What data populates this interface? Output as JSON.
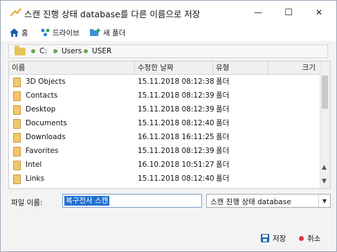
{
  "window": {
    "title": "스캔 진행 상태 database를 다른 이름으로 저장",
    "controls": {
      "minimize": "—",
      "maximize": "☐",
      "close": "✕"
    }
  },
  "toolbar": {
    "home": "홈",
    "drives": "드라이브",
    "new_folder": "새 폴더"
  },
  "path": {
    "segments": [
      "C:",
      "Users",
      "USER"
    ]
  },
  "table": {
    "columns": [
      "이름",
      "수정한 날짜",
      "유형",
      "크기"
    ],
    "rows": [
      {
        "name": "3D Objects",
        "date": "15.11.2018 08:12:38",
        "type": "폴더"
      },
      {
        "name": "Contacts",
        "date": "15.11.2018 08:12:39",
        "type": "폴더"
      },
      {
        "name": "Desktop",
        "date": "15.11.2018 08:12:39",
        "type": "폴더"
      },
      {
        "name": "Documents",
        "date": "15.11.2018 08:12:40",
        "type": "폴더"
      },
      {
        "name": "Downloads",
        "date": "16.11.2018 16:11:25",
        "type": "폴더"
      },
      {
        "name": "Favorites",
        "date": "15.11.2018 08:12:39",
        "type": "폴더"
      },
      {
        "name": "Intel",
        "date": "16.10.2018 10:51:27",
        "type": "폴더"
      },
      {
        "name": "Links",
        "date": "15.11.2018 08:12:40",
        "type": "폴더"
      }
    ]
  },
  "filename": {
    "label": "파일 이름:",
    "value": "복구전사 스캔"
  },
  "filetype": {
    "selected": "스캔 진행 상태 database"
  },
  "buttons": {
    "save": "저장",
    "cancel": "취소"
  },
  "colors": {
    "accent": "#1f6fd1",
    "folder": "#f2c76a",
    "cancel_dot": "#e0303a",
    "path_dot": "#6aa84f"
  }
}
